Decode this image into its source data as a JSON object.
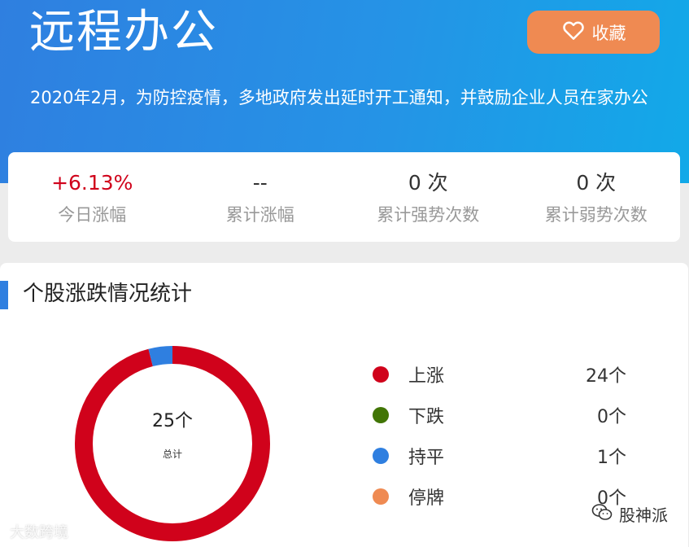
{
  "header": {
    "title": "远程办公",
    "favorite_label": "收藏",
    "description": "2020年2月，为防控疫情，多地政府发出延时开工通知，并鼓励企业人员在家办公"
  },
  "stats": [
    {
      "value": "+6.13%",
      "label": "今日涨幅"
    },
    {
      "value": "--",
      "label": "累计涨幅"
    },
    {
      "value": "0 次",
      "label": "累计强势次数"
    },
    {
      "value": "0 次",
      "label": "累计弱势次数"
    }
  ],
  "panel": {
    "title": "个股涨跌情况统计",
    "total_count": "25个",
    "total_label": "总计"
  },
  "legend": [
    {
      "label": "上涨",
      "value": "24个",
      "color": "#d0021b"
    },
    {
      "label": "下跌",
      "value": "0个",
      "color": "#417505"
    },
    {
      "label": "持平",
      "value": "1个",
      "color": "#2f7fe0"
    },
    {
      "label": "停牌",
      "value": "0个",
      "color": "#ef8a52"
    }
  ],
  "donut": {
    "segments": [
      {
        "name": "上涨",
        "value": 24,
        "color": "#d0021b"
      },
      {
        "name": "持平",
        "value": 1,
        "color": "#2f7fe0"
      }
    ]
  },
  "watermarks": {
    "left": "大数跨境",
    "right": "股神派"
  },
  "icons": {
    "favorite": "heart-icon",
    "wechat": "wechat-icon"
  }
}
